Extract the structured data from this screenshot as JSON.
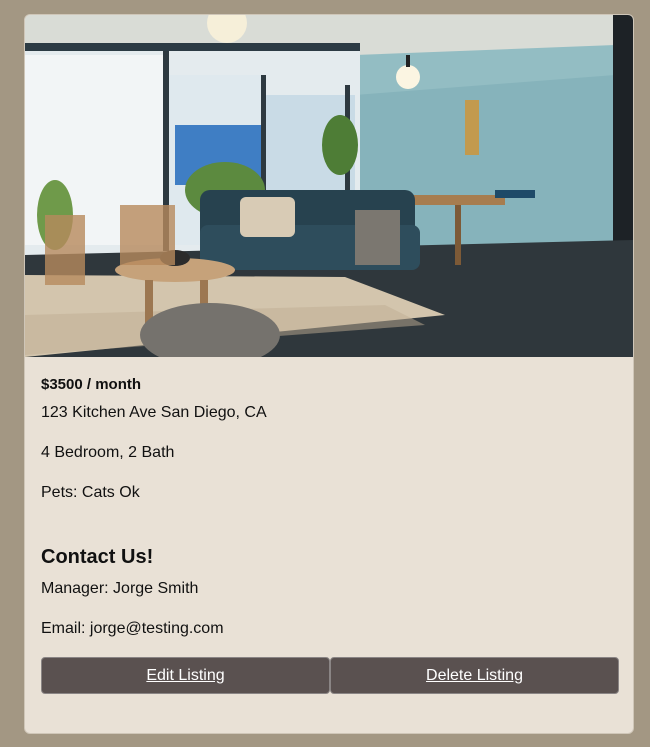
{
  "listing": {
    "price": "$3500 / month",
    "address": "123 Kitchen Ave San Diego, CA",
    "rooms": "4 Bedroom, 2 Bath",
    "pets": "Pets: Cats Ok"
  },
  "contact": {
    "title": "Contact Us!",
    "manager": "Manager: Jorge Smith",
    "email": "Email: jorge@testing.com"
  },
  "actions": {
    "edit_label": "Edit Listing",
    "delete_label": "Delete Listing"
  },
  "colors": {
    "page_bg": "#a39783",
    "card_bg": "#e9e1d6",
    "button_bg": "#5a5150"
  }
}
